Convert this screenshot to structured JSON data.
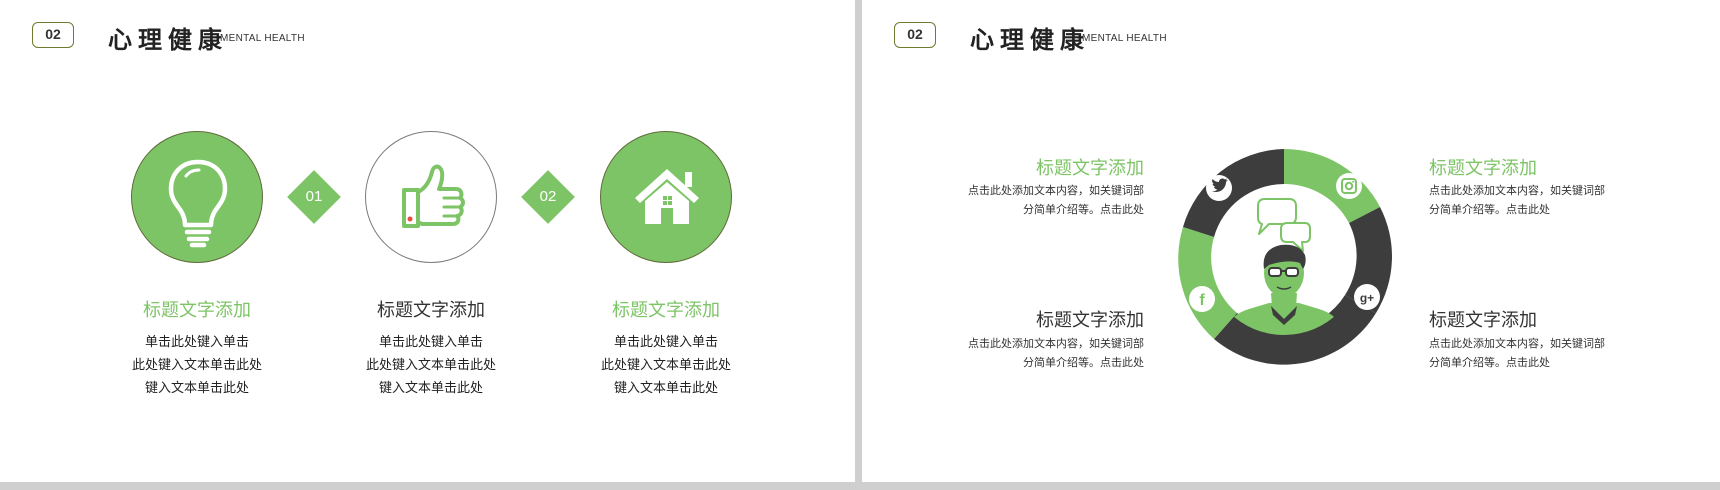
{
  "slide1": {
    "badge": "02",
    "title": "心理健康",
    "subtitle": "MENTAL HEALTH",
    "steps": [
      "01",
      "02"
    ],
    "columns": [
      {
        "title": "标题文字添加",
        "lines": [
          "单击此处键入单击",
          "此处键入文本单击此处",
          "键入文本单击此处"
        ]
      },
      {
        "title": "标题文字添加",
        "lines": [
          "单击此处键入单击",
          "此处键入文本单击此处",
          "键入文本单击此处"
        ]
      },
      {
        "title": "标题文字添加",
        "lines": [
          "单击此处键入单击",
          "此处键入文本单击此处",
          "键入文本单击此处"
        ]
      }
    ],
    "icons": [
      "lightbulb-icon",
      "thumbs-up-icon",
      "house-icon"
    ]
  },
  "slide2": {
    "badge": "02",
    "title": "心理健康",
    "subtitle": "MENTAL HEALTH",
    "blocks": [
      {
        "title": "标题文字添加",
        "lines": [
          "点击此处添加文本内容，如关键词部",
          "分简单介绍等。点击此处"
        ]
      },
      {
        "title": "标题文字添加",
        "lines": [
          "点击此处添加文本内容，如关键词部",
          "分简单介绍等。点击此处"
        ]
      },
      {
        "title": "标题文字添加",
        "lines": [
          "点击此处添加文本内容，如关键词部",
          "分简单介绍等。点击此处"
        ]
      },
      {
        "title": "标题文字添加",
        "lines": [
          "点击此处添加文本内容，如关键词部",
          "分简单介绍等。点击此处"
        ]
      }
    ],
    "ring_icons": [
      "twitter-icon",
      "instagram-icon",
      "facebook-icon",
      "google-plus-icon"
    ],
    "center_icons": [
      "speech-bubbles-icon",
      "person-with-glasses-icon"
    ],
    "social_glyphs": {
      "facebook": "f",
      "google_plus": "g+"
    }
  },
  "colors": {
    "green": "#7dc466",
    "dark": "#3d3d3d",
    "olive": "#6b7d2c"
  }
}
